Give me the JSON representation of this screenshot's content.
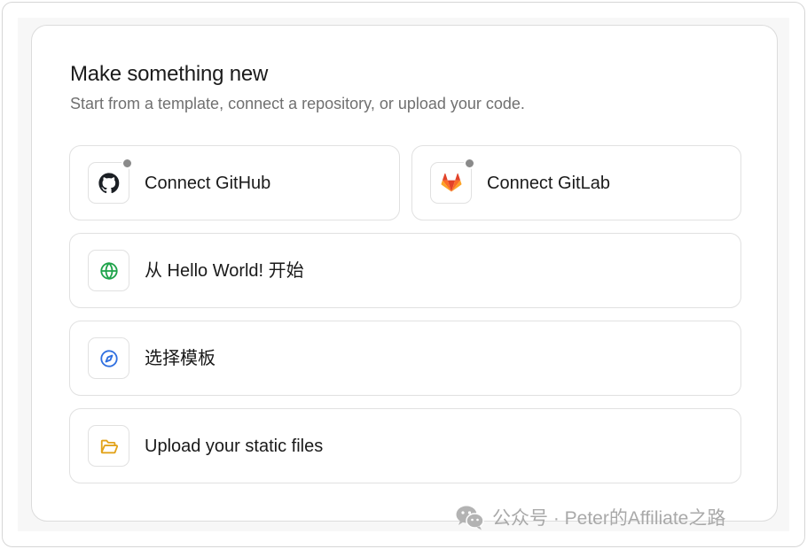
{
  "header": {
    "title": "Make something new",
    "subtitle": "Start from a template, connect a repository, or upload your code."
  },
  "options": [
    {
      "label": "Connect GitHub",
      "icon": "github-icon",
      "color": "#1b1f24",
      "has_status_dot": true
    },
    {
      "label": "Connect GitLab",
      "icon": "gitlab-icon",
      "color": "#e24329",
      "has_status_dot": true
    },
    {
      "label": "从 Hello World! 开始",
      "icon": "globe-icon",
      "color": "#1ea34a",
      "has_status_dot": false
    },
    {
      "label": "选择模板",
      "icon": "compass-icon",
      "color": "#2f6fe0",
      "has_status_dot": false
    },
    {
      "label": "Upload your static files",
      "icon": "folder-icon",
      "color": "#e2a31b",
      "has_status_dot": false
    }
  ],
  "watermark": {
    "text": "公众号 · Peter的Affiliate之路",
    "icon": "wechat-icon"
  }
}
